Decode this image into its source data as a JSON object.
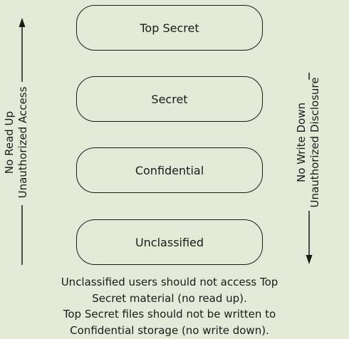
{
  "levels": [
    "Top Secret",
    "Secret",
    "Confidential",
    "Unclassified"
  ],
  "left_label": {
    "line1": "No Read Up",
    "line2": "Unauthorized Access"
  },
  "right_label": {
    "line1": "No Write Down",
    "line2": "Unauthorized Disclosure"
  },
  "caption": {
    "line1": "Unclassified users should not access Top",
    "line2": "Secret material (no read up).",
    "line3": "Top Secret files should not be written to",
    "line4": "Confidential storage (no write down)."
  },
  "colors": {
    "background": "#e3ebd8",
    "stroke": "#1a1a1a"
  }
}
